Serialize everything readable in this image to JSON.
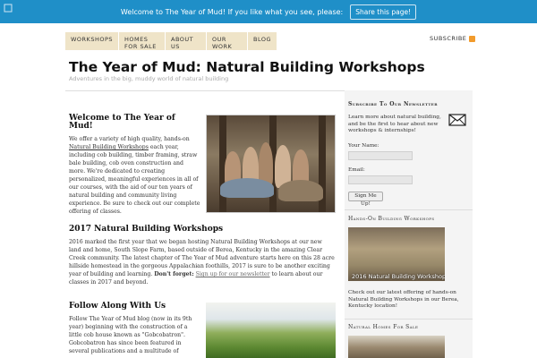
{
  "hellobar": {
    "message": "Welcome to The Year of Mud! If you like what you see, please:",
    "button": "Share this page!"
  },
  "nav": {
    "items": [
      "Workshops",
      "Homes for Sale",
      "About Us",
      "Our Work",
      "Blog"
    ],
    "subscribe": "SUBSCRIBE"
  },
  "site": {
    "title": "The Year of Mud: Natural Building Workshops",
    "tagline": "Adventures in the big, muddy world of natural building"
  },
  "main": {
    "welcome_heading": "Welcome to The Year of Mud!",
    "welcome_intro": "We offer a variety of high quality, hands-on",
    "welcome_link": "Natural Building Workshops",
    "welcome_body": " each year, including cob building, timber framing, straw bale building, cob oven construction and more. We're dedicated to creating personalized, meaningful experiences in all of our courses, with the aid of our ten years of natural building and community living experience. Be sure to check out our complete offering of classes.",
    "workshops_heading": "2017 Natural Building Workshops",
    "workshops_body": "2016 marked the first year that we began hosting Natural Building Workshops at our new land and home, South Slope Farm, based outside of Berea, Kentucky in the amazing Clear Creek community. The latest chapter of The Year of Mud adventure starts here on this 28 acre hillside homestead in the gorgeous Appalachian foothills, 2017 is sure to be another exciting year of building and learning.",
    "dont_forget": "Don't forget:",
    "newsletter_link": "Sign up for our newsletter",
    "workshops_tail": " to learn about our classes in 2017 and beyond.",
    "follow_heading": "Follow Along With Us",
    "follow_body": "Follow The Year of Mud blog (now in its 9th year) beginning with the construction of a little cob house known as \"Gobcobatron\". Gobcobatron has since been featured in several publications and a multitude of"
  },
  "sidebar": {
    "newsletter_title": "Subscribe To Our Newsletter",
    "newsletter_text": "Learn more about natural building, and be the first to hear about new workshops & internships!",
    "name_label": "Your Name:",
    "email_label": "Email:",
    "signup_button": "Sign Me Up!",
    "workshops_title": "Hands-On Building Workshops",
    "workshops_caption": "2016 Natural Building Workshops",
    "workshops_text": "Check out our latest offering of hands-on Natural Building Workshops in our Berea, Kentucky location!",
    "homes_title": "Natural Homes For Sale"
  },
  "colors": {
    "hellobar": "#1f8fc8",
    "nav_bg": "#efe4c8",
    "rss": "#f29b2c",
    "sidebar_bg": "#f4f4f4"
  }
}
